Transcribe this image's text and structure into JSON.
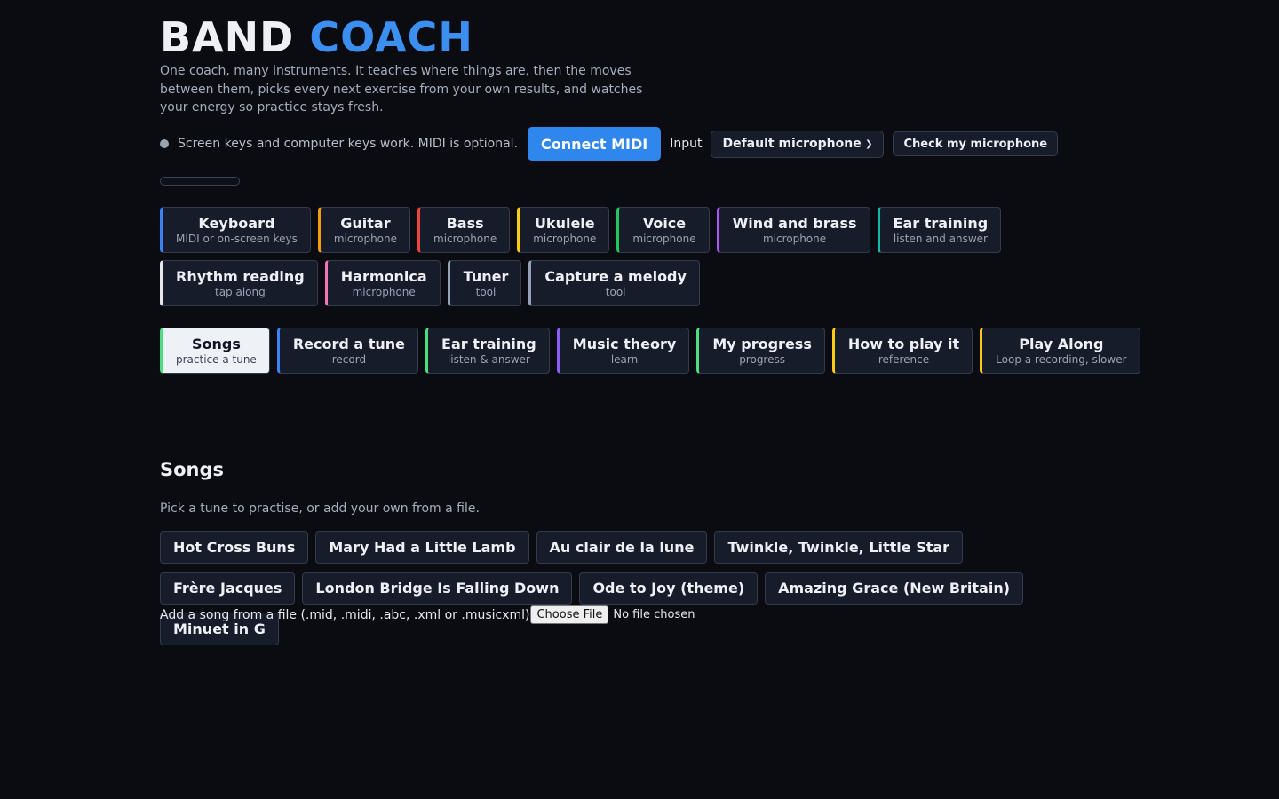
{
  "header": {
    "brand_word1": "BAND",
    "brand_word2": "COACH",
    "tagline": "One coach, many instruments. It teaches where things are, then the moves between them, picks every next exercise from your own results, and watches your energy so practice stays fresh."
  },
  "status": {
    "text": "Screen keys and computer keys work. MIDI is optional.",
    "connect_midi": "Connect MIDI",
    "input_label": "Input",
    "input_selected": "Default microphone",
    "check_mic": "Check my microphone",
    "mic_level": 0
  },
  "instruments": [
    {
      "title": "Keyboard",
      "sub": "MIDI or on-screen keys",
      "color": "#3b82f6"
    },
    {
      "title": "Guitar",
      "sub": "microphone",
      "color": "#f59e0b"
    },
    {
      "title": "Bass",
      "sub": "microphone",
      "color": "#ef4444"
    },
    {
      "title": "Ukulele",
      "sub": "microphone",
      "color": "#facc15"
    },
    {
      "title": "Voice",
      "sub": "microphone",
      "color": "#22c55e"
    },
    {
      "title": "Wind and brass",
      "sub": "microphone",
      "color": "#a855f7"
    },
    {
      "title": "Ear training",
      "sub": "listen and answer",
      "color": "#14b8a6"
    },
    {
      "title": "Rhythm reading",
      "sub": "tap along",
      "color": "#e5e7eb"
    },
    {
      "title": "Harmonica",
      "sub": "microphone",
      "color": "#f472b6"
    },
    {
      "title": "Tuner",
      "sub": "tool",
      "color": "#94a3b8"
    },
    {
      "title": "Capture a melody",
      "sub": "tool",
      "color": "#94a3b8"
    }
  ],
  "modes": [
    {
      "title": "Songs",
      "sub": "practice a tune",
      "color": "#4ade80",
      "active": true
    },
    {
      "title": "Record a tune",
      "sub": "record",
      "color": "#3b82f6"
    },
    {
      "title": "Ear training",
      "sub": "listen & answer",
      "color": "#4ade80"
    },
    {
      "title": "Music theory",
      "sub": "learn",
      "color": "#8b5cf6"
    },
    {
      "title": "My progress",
      "sub": "progress",
      "color": "#4ade80"
    },
    {
      "title": "How to play it",
      "sub": "reference",
      "color": "#facc15"
    },
    {
      "title": "Play Along",
      "sub": "Loop a recording, slower",
      "color": "#facc15"
    }
  ],
  "songs_section": {
    "title": "Songs",
    "description": "Pick a tune to practise, or add your own from a file.",
    "songs": [
      "Hot Cross Buns",
      "Mary Had a Little Lamb",
      "Au clair de la lune",
      "Twinkle, Twinkle, Little Star",
      "Frère Jacques",
      "London Bridge Is Falling Down",
      "Ode to Joy (theme)",
      "Amazing Grace (New Britain)",
      "Minuet in G"
    ],
    "file_label": "Add a song from a file (.mid, .midi, .abc, .xml or .musicxml)",
    "choose_file": "Choose File",
    "no_file": "No file chosen"
  }
}
